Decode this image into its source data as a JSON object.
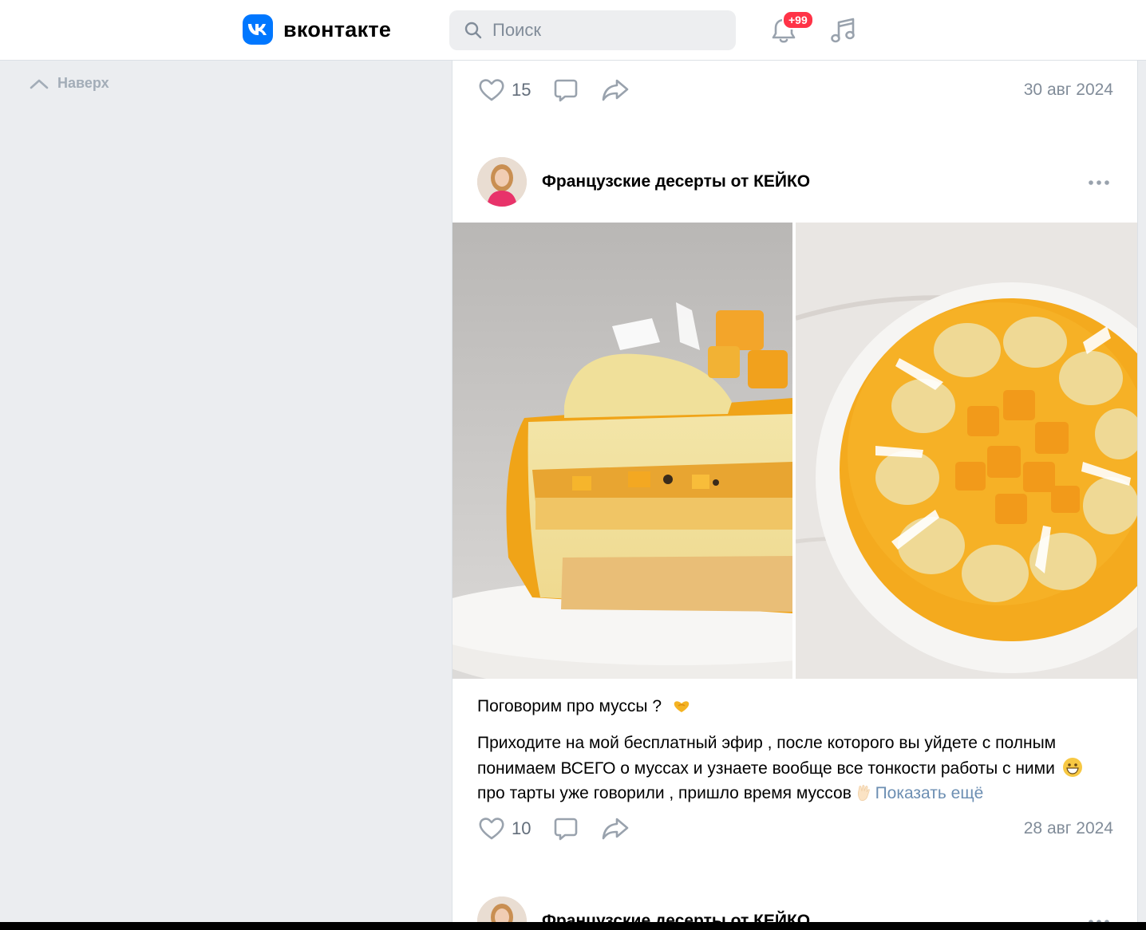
{
  "header": {
    "logo_mark": "VK",
    "logo_text": "вконтакте",
    "search_placeholder": "Поиск",
    "notifications_badge": "+99",
    "icons": [
      "search-icon",
      "bell-icon",
      "music-icon"
    ]
  },
  "sidebar": {
    "back_to_top": "Наверх"
  },
  "posts": [
    {
      "likes": "15",
      "date": "30 авг 2024"
    },
    {
      "author": "Французские десерты от КЕЙКО",
      "title": "Поговорим про муссы ?",
      "body_line1": "Приходите на мой бесплатный эфир , после которого вы уйдете с полным",
      "body_line2": "понимаем ВСЕГО о муссах и узнаете вообще все тонкости работы с ними",
      "body_line3": "про тарты уже говорили , пришло время муссов",
      "show_more": "Показать ещё",
      "likes": "10",
      "date": "28 авг 2024"
    },
    {
      "author": "Французские десерты от КЕЙКО"
    }
  ],
  "colors": {
    "accent": "#0077ff",
    "badge": "#ff3347",
    "link": "#6d8fb3",
    "muted": "#818c99"
  }
}
